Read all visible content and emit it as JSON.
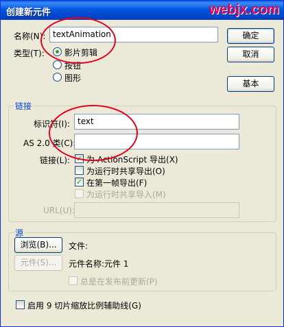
{
  "window": {
    "title": "创建新元件",
    "close_glyph": "✕"
  },
  "watermark": "webjx.com",
  "name_field": {
    "label": "名称(N):",
    "value": "textAnimation"
  },
  "type_group": {
    "label": "类型(T):",
    "options": [
      {
        "label": "影片剪辑",
        "selected": true
      },
      {
        "label": "按钮",
        "selected": false
      },
      {
        "label": "图形",
        "selected": false
      }
    ]
  },
  "buttons": {
    "ok": "确定",
    "cancel": "取消",
    "basic": "基本"
  },
  "linkage_section": {
    "title": "链接",
    "identifier_label": "标识符(I):",
    "identifier_value": "text",
    "as_class_label": "AS 2.0 类(C):",
    "as_class_value": "",
    "linkage_label": "链接(L):",
    "checkboxes": [
      {
        "label": "为 ActionScript 导出(X)",
        "checked": true,
        "enabled": true
      },
      {
        "label": "为运行时共享导出(O)",
        "checked": false,
        "enabled": true
      },
      {
        "label": "在第一帧导出(F)",
        "checked": true,
        "enabled": true
      },
      {
        "label": "为运行时共享导入(M)",
        "checked": false,
        "enabled": false
      }
    ],
    "url_label": "URL(U):",
    "url_value": ""
  },
  "source_section": {
    "title": "源",
    "browse_button": "浏览(B)...",
    "file_label": "文件:",
    "symbol_button": "元件(S)...",
    "symbol_name": "元件名称:元件 1",
    "always_update_label": "总是在发布前更新(P)"
  },
  "scale_guides_label": "启用 9 切片缩放比例辅助线(G)",
  "colors": {
    "title_bar": "#0355e0",
    "section_title": "#0046d5",
    "annotation": "#e0001b",
    "watermark": "#e5004f"
  }
}
